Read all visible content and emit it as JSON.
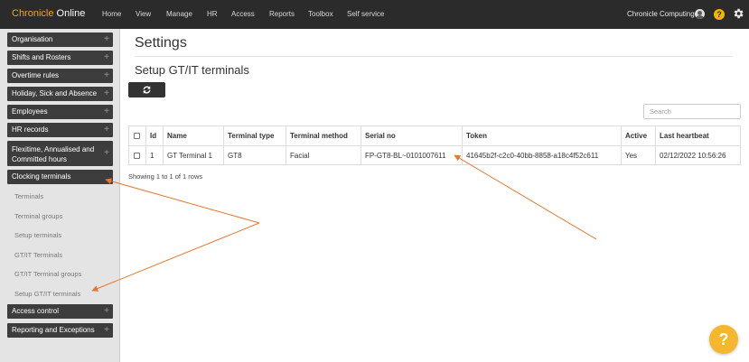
{
  "app": {
    "brand_part1": "Chronicle",
    "brand_part2": " Online",
    "brand_color": "#f0a32f"
  },
  "topnav": {
    "items": [
      "Home",
      "View",
      "Manage",
      "HR",
      "Access",
      "Reports",
      "Toolbox",
      "Self service"
    ],
    "user_name": "Chronicle Computing",
    "help_label": "?",
    "settings_icon": "gear-icon"
  },
  "sidebar": {
    "groups": [
      {
        "label": "Organisation",
        "expand": "+"
      },
      {
        "label": "Shifts and Rosters",
        "expand": "+"
      },
      {
        "label": "Overtime rules",
        "expand": "+"
      },
      {
        "label": "Holiday, Sick and Absence",
        "expand": "+"
      },
      {
        "label": "Employees",
        "expand": "+"
      },
      {
        "label": "HR records",
        "expand": "+"
      },
      {
        "label_line1": "Flexitime, Annualised and",
        "label_line2": "Committed hours",
        "expand": "+"
      },
      {
        "label": "Clocking terminals",
        "expand": ""
      },
      {
        "label": "Access control",
        "expand": "+"
      },
      {
        "label": "Reporting and Exceptions",
        "expand": "+"
      }
    ],
    "clocking_sub_items": [
      "Terminals",
      "Terminal groups",
      "Setup terminals",
      "GT/IT Terminals",
      "GT/IT Terminal groups",
      "Setup GT/IT terminals"
    ]
  },
  "main": {
    "title": "Settings",
    "subtitle": "Setup GT/IT terminals",
    "refresh_icon": "refresh-icon",
    "search_placeholder": "Search",
    "table": {
      "columns": [
        "",
        "Id",
        "Name",
        "Terminal type",
        "Terminal method",
        "Serial no",
        "Token",
        "Active",
        "Last heartbeat"
      ],
      "rows": [
        {
          "id": "1",
          "name": "GT Terminal 1",
          "terminal_type": "GT8",
          "terminal_method": "Facial",
          "serial_no": "FP-GT8-BL~0101007611",
          "token": "41645b2f-c2c0-40bb-8858-a18c4f52c611",
          "active": "Yes",
          "last_heartbeat": "02/12/2022 10:56:26"
        }
      ]
    },
    "rows_info": "Showing 1 to 1 of 1 rows"
  },
  "help_button": {
    "label": "?",
    "color": "#f5b72b"
  },
  "annotation_color": "#e8772e"
}
